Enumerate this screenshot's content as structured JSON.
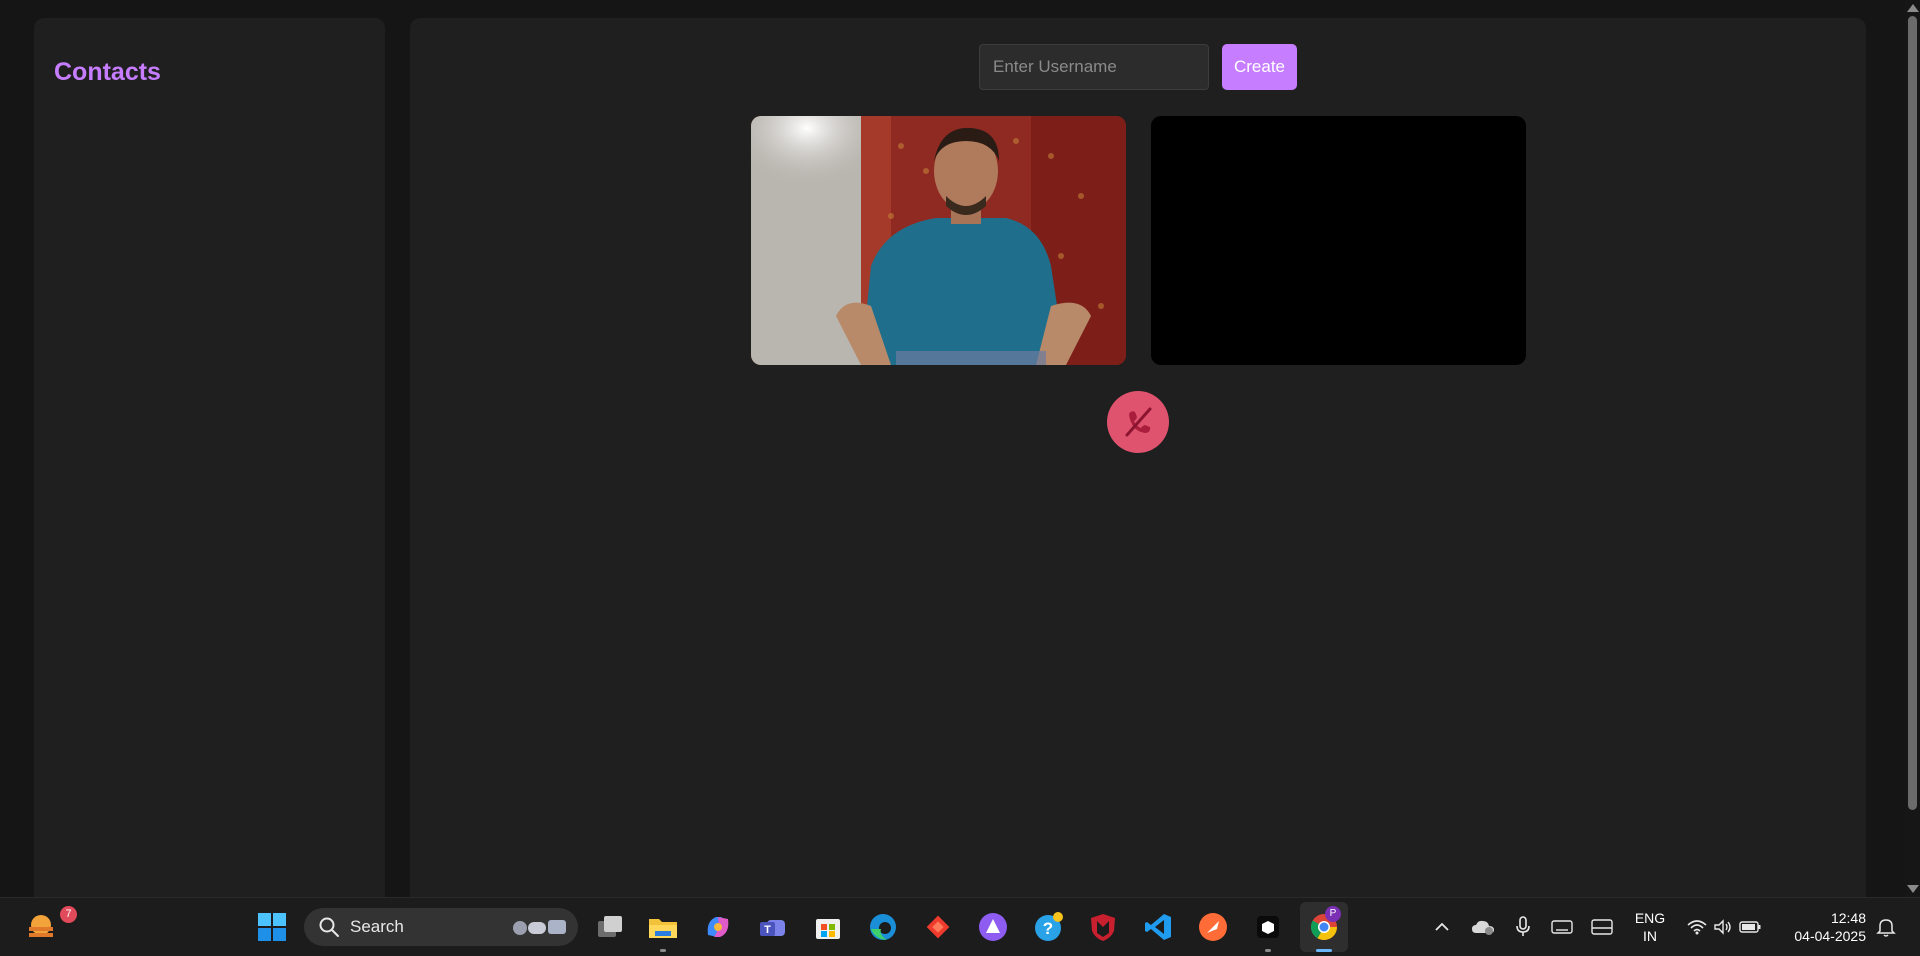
{
  "sidebar": {
    "title": "Contacts"
  },
  "main": {
    "username_placeholder": "Enter Username",
    "username_value": "",
    "create_label": "Create",
    "end_call_icon": "phone-slash-icon"
  },
  "colors": {
    "accent": "#c77dff",
    "end_call": "#e0536e",
    "panel_bg": "#1f1f1f",
    "page_bg": "#151515"
  },
  "taskbar": {
    "weather_badge": "7",
    "search_label": "Search",
    "profile_badge": "P",
    "language": "ENG",
    "region": "IN",
    "time": "12:48",
    "date": "04-04-2025"
  }
}
